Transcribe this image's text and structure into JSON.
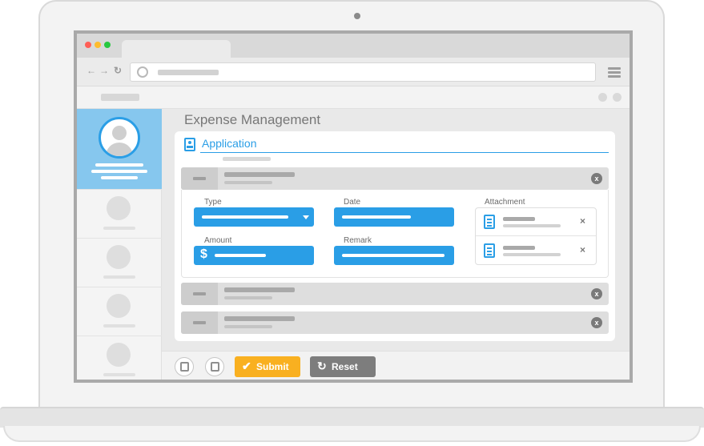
{
  "app": {
    "title": "Expense Management"
  },
  "application": {
    "title": "Application"
  },
  "form": {
    "type_label": "Type",
    "date_label": "Date",
    "attachment_label": "Attachment",
    "amount_label": "Amount",
    "remark_label": "Remark",
    "currency_symbol": "$"
  },
  "rows": {
    "remove_glyph": "x"
  },
  "attachments": {
    "remove_glyph": "×"
  },
  "footer": {
    "submit_label": "Submit",
    "reset_label": "Reset"
  },
  "colors": {
    "accent": "#2a9ee6",
    "sidebar_active": "#86c7ee",
    "submit": "#f9b020",
    "reset": "#7d7d7d"
  },
  "icons": {
    "app": "id-card-icon",
    "file": "document-icon",
    "submit": "check-icon",
    "reset": "refresh-icon",
    "add": "add-file-icon",
    "save": "save-icon"
  }
}
